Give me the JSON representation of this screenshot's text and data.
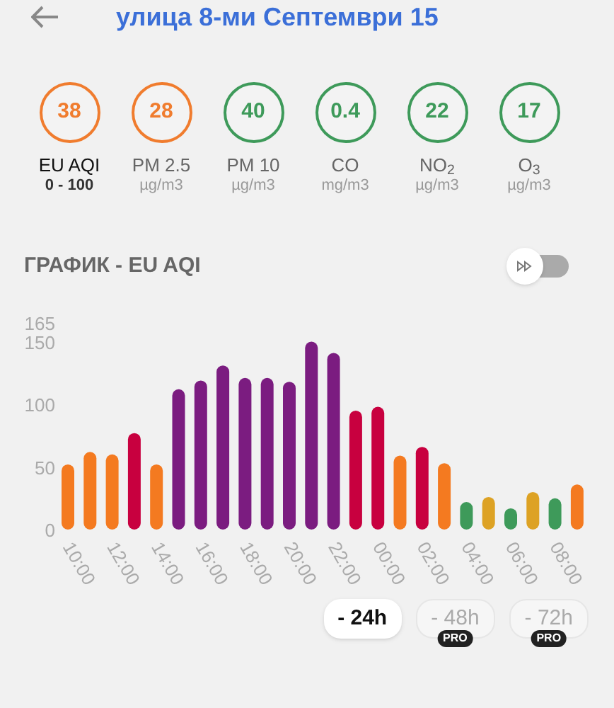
{
  "header": {
    "title": "улица 8-ми Септември 15"
  },
  "pollutants": [
    {
      "value": "38",
      "label": "EU AQI",
      "unit": "0 - 100",
      "color": "#f07c2e",
      "selected": true
    },
    {
      "value": "28",
      "label": "PM 2.5",
      "unit": "µg/m3",
      "color": "#f07c2e",
      "selected": false
    },
    {
      "value": "40",
      "label": "PM 10",
      "unit": "µg/m3",
      "color": "#3e9a5a",
      "selected": false
    },
    {
      "value": "0.4",
      "label": "CO",
      "unit": "mg/m3",
      "color": "#3e9a5a",
      "selected": false
    },
    {
      "value": "22",
      "label": "NO$_{2}$",
      "unit": "µg/m3",
      "color": "#3e9a5a",
      "selected": false
    },
    {
      "value": "17",
      "label": "O$_{3}$",
      "unit": "µg/m3",
      "color": "#3e9a5a",
      "selected": false
    }
  ],
  "chart_section": {
    "title": "ГРАФИК - EU AQI",
    "forecast_toggle": {
      "on": false
    },
    "chart_data": {
      "type": "bar",
      "categories": [
        "10:00",
        null,
        "12:00",
        null,
        "14:00",
        null,
        "16:00",
        null,
        "18:00",
        null,
        "20:00",
        null,
        "22:00",
        null,
        "00:00",
        null,
        "02:00",
        null,
        "04:00",
        null,
        "06:00",
        null,
        "08:00",
        null
      ],
      "series": [
        {
          "color": "#3e9a5a",
          "values": [
            null,
            null,
            null,
            null,
            null,
            null,
            null,
            null,
            null,
            null,
            null,
            null,
            null,
            null,
            null,
            null,
            null,
            null,
            22,
            null,
            17,
            null,
            25,
            null
          ]
        },
        {
          "color": "#dda224",
          "values": [
            null,
            null,
            null,
            null,
            null,
            null,
            null,
            null,
            null,
            null,
            null,
            null,
            null,
            null,
            null,
            null,
            null,
            null,
            null,
            26,
            null,
            30,
            null,
            null
          ]
        },
        {
          "color": "#f47a20",
          "values": [
            52,
            62,
            60,
            null,
            52,
            null,
            null,
            null,
            null,
            null,
            null,
            null,
            null,
            null,
            null,
            59,
            null,
            53,
            null,
            null,
            null,
            null,
            null,
            36
          ]
        },
        {
          "color": "#c8003f",
          "values": [
            null,
            null,
            null,
            77,
            null,
            null,
            null,
            null,
            null,
            null,
            null,
            null,
            null,
            95,
            98,
            null,
            66,
            null,
            null,
            null,
            null,
            null,
            null,
            null
          ]
        },
        {
          "color": "#7b1c80",
          "values": [
            null,
            null,
            null,
            null,
            null,
            112,
            119,
            131,
            121,
            121,
            118,
            150,
            141,
            null,
            null,
            null,
            null,
            null,
            null,
            null,
            null,
            null,
            null,
            null
          ]
        }
      ],
      "ylim": [
        0,
        165
      ],
      "yticks": [
        0,
        50,
        100,
        150,
        165
      ]
    }
  },
  "ranges": [
    {
      "label": "- 24h",
      "selected": true
    },
    {
      "label": "- 48h",
      "selected": false,
      "badge": "PRO"
    },
    {
      "label": "- 72h",
      "selected": false,
      "badge": "PRO"
    }
  ]
}
